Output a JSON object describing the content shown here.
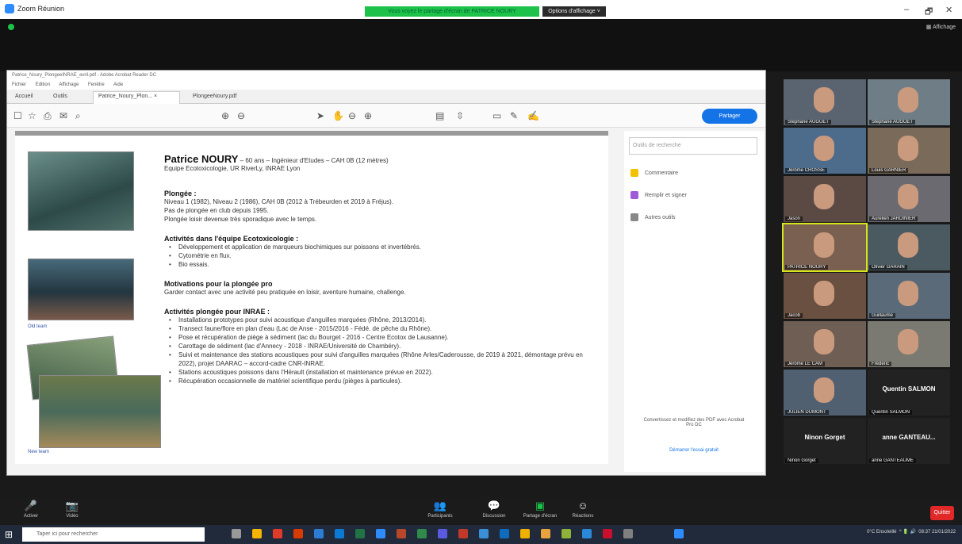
{
  "window": {
    "title": "Zoom Réunion",
    "share_banner": "Vous voyez le partage d'écran de PATRICE NOURY",
    "view_options": "Options d'affichage ˅",
    "view_label": "Affichage",
    "min": "–",
    "max": "🗗",
    "close": "✕"
  },
  "acrobat": {
    "title": "Patrice_Noury_PlongeeINRAE_avril.pdf - Adobe Acrobat Reader DC",
    "menu": [
      "Fichier",
      "Edition",
      "Affichage",
      "Fenêtre",
      "Aide"
    ],
    "tabs": [
      "Accueil",
      "Outils",
      "Patrice_Noury_Plon... ×",
      "PlongeeNoury.pdf"
    ],
    "share_label": "Partager",
    "search_placeholder": "Outils de recherche",
    "right_tools": [
      "Commentaire",
      "Remplir et signer",
      "Autres outils"
    ],
    "right_footer": "Convertissez et modifiez des PDF avec Acrobat Pro DC",
    "right_footer_link": "Démarrer l'essai gratuit"
  },
  "doc": {
    "name": "Patrice NOURY",
    "name_rest": " – 60 ans – Ingénieur d'Etudes – CAH 0B (12 mètres)",
    "team": "Equipe Ecotoxicologie, UR RiverLy, INRAE Lyon",
    "plongee_h": "Plongée :",
    "plongee_lines": [
      "Niveau 1 (1982), Niveau 2 (1986), CAH 0B (2012 à Trébeurden et 2019 à Fréjus).",
      "Pas de plongée en club depuis 1995.",
      "Plongée loisir devenue très sporadique avec le temps."
    ],
    "activites_h": "Activités dans l'équipe Ecotoxicologie :",
    "activites": [
      "Développement et application de marqueurs biochimiques sur poissons et invertébrés.",
      "Cytométrie en flux.",
      "Bio essais."
    ],
    "motivations_h": "Motivations pour la plongée pro",
    "motivations": "Garder contact avec une activité peu pratiquée en loisir, aventure humaine, challenge.",
    "inrae_h": "Activités plongée pour INRAE :",
    "inrae": [
      "Installations prototypes pour suivi acoustique d'anguilles marquées (Rhône, 2013/2014).",
      "Transect faune/flore en plan d'eau (Lac de Anse - 2015/2016 - Fédé. de pêche du Rhône).",
      "Pose et récupération de piège à sédiment (lac du Bourget - 2016 - Centre Ecotox de Lausanne).",
      "Carottage de sédiment (lac d'Annecy - 2018 - INRAE/Université de Chambéry).",
      "Suivi et maintenance des stations acoustiques pour suivi d'anguilles marquées (Rhône Arles/Caderousse, de 2019 à 2021, démontage prévu en 2022), projet DAARAC – accord-cadre CNR-INRAE.",
      "Stations acoustiques poissons dans l'Hérault (installation et maintenance prévue en 2022).",
      "Récupération occasionnelle de matériel scientifique perdu (pièges à particules)."
    ],
    "caption_old": "Old team",
    "caption_new": "New team"
  },
  "participants": [
    {
      "name": "Stéphane AUGUET"
    },
    {
      "name": "Stéphane AUGUET"
    },
    {
      "name": "Jérôme CROSSE"
    },
    {
      "name": "Louis GARNIER"
    },
    {
      "name": "Jason"
    },
    {
      "name": "Aurelien JARDINIER"
    },
    {
      "name": "PATRICE NOURY"
    },
    {
      "name": "Olivier GARAIN"
    },
    {
      "name": "Jacob"
    },
    {
      "name": "Guillaume"
    },
    {
      "name": "Jérôme LE CAM"
    },
    {
      "name": "Frédéric"
    },
    {
      "name": "JULIEN DUMONT"
    },
    {
      "name": "Quentin SALMON",
      "big": "Quentin SALMON"
    },
    {
      "name": "Ninon Gorget",
      "big": "Ninon Gorget"
    },
    {
      "name": "anne GANTEAUME",
      "big": "anne GANTEAU..."
    }
  ],
  "controls": {
    "audio": "Activer",
    "video": "Vidéo",
    "participants": "Participants",
    "chat": "Discussion",
    "share": "Partage d'écran",
    "reactions": "Réactions",
    "quit": "Quitter"
  },
  "taskbar": {
    "search": "Taper ici pour rechercher",
    "weather": "0°C Ensoleillé",
    "time": "08:37",
    "date": "21/01/2022"
  }
}
